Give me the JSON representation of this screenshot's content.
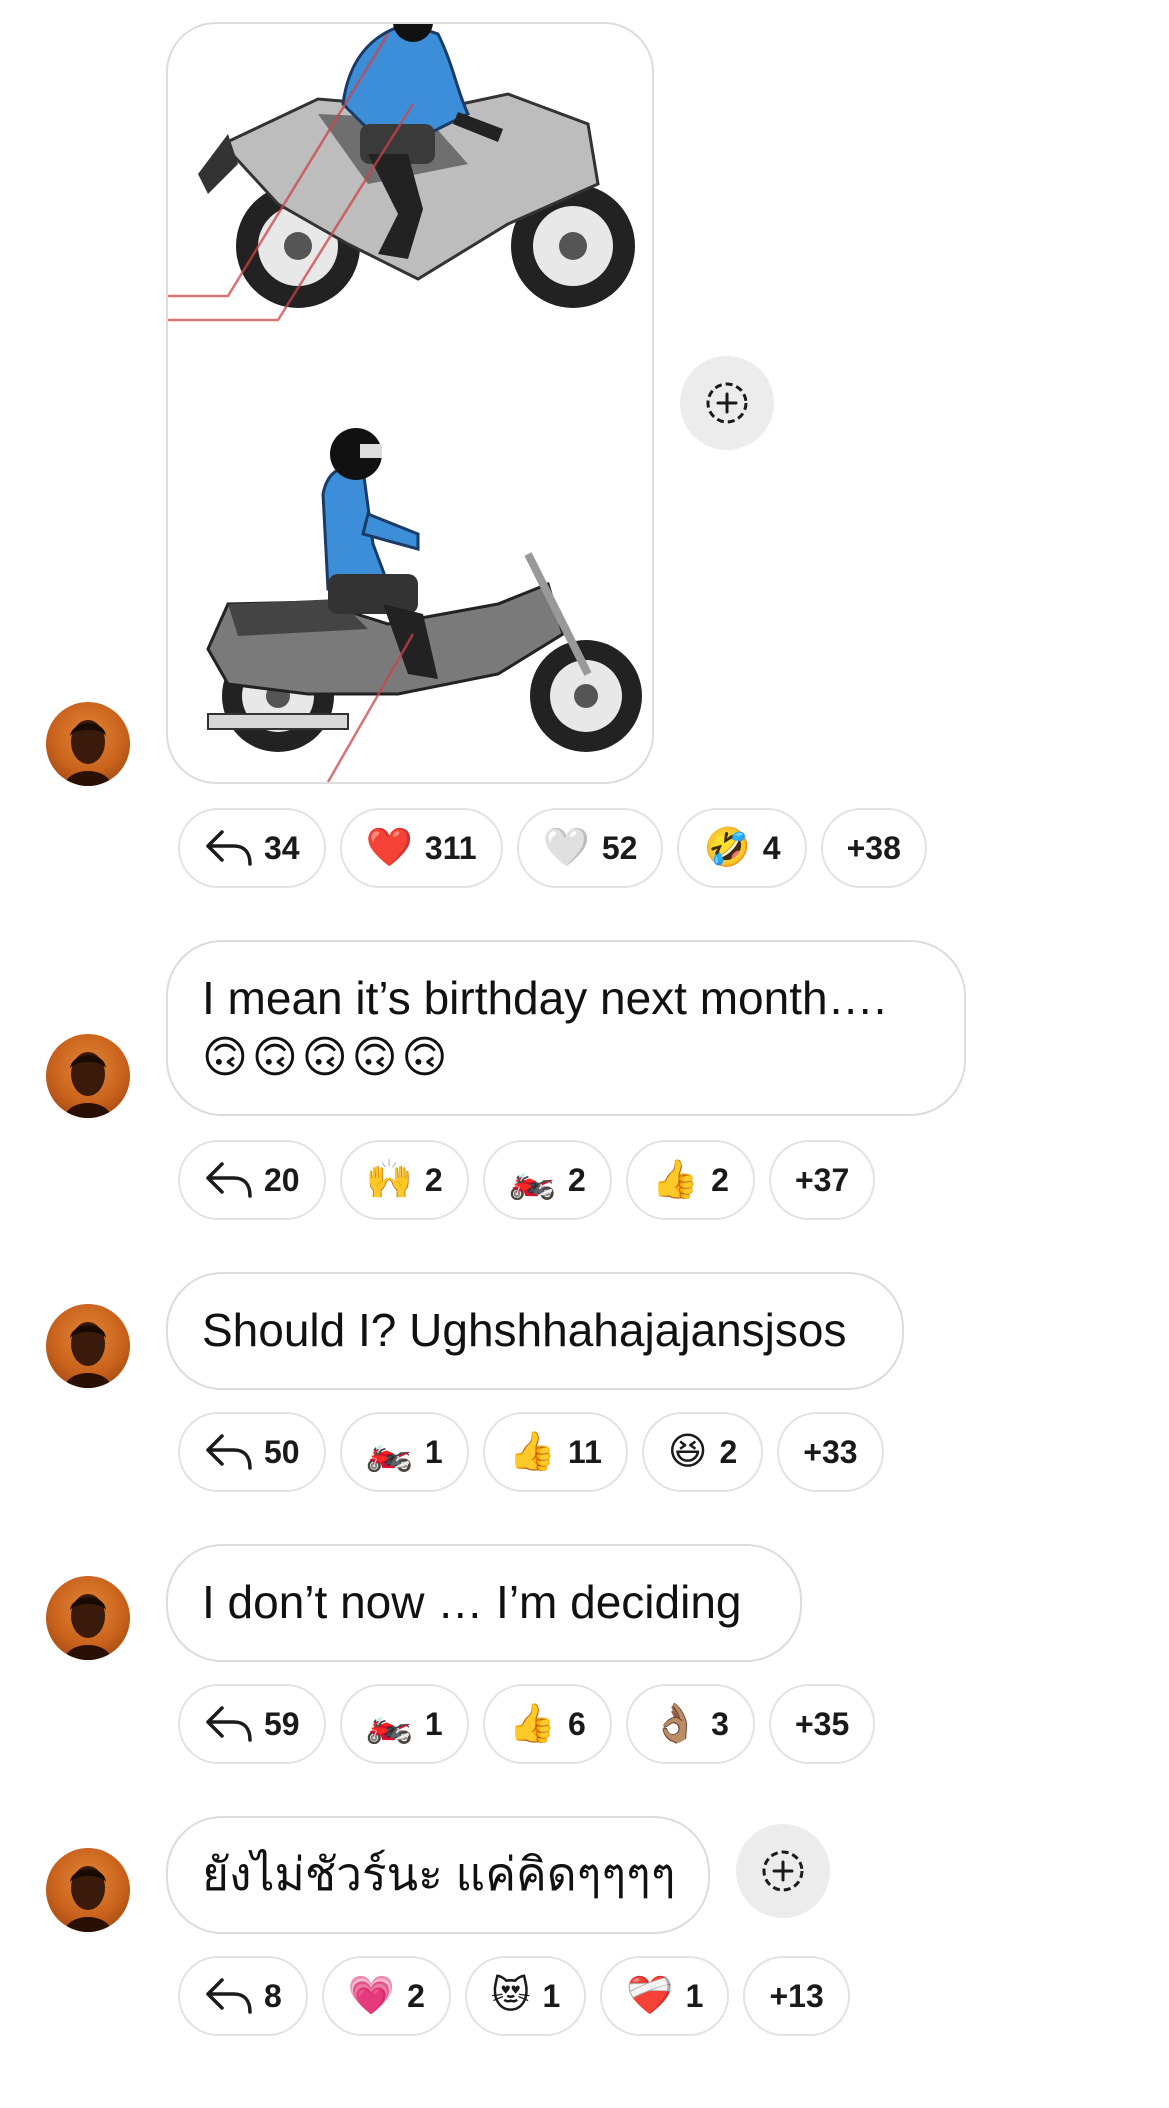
{
  "messages": [
    {
      "type": "image",
      "image_alt": "Two motorcycle riding posture illustrations",
      "reactions": {
        "replies": "34",
        "items": [
          {
            "emoji": "❤️",
            "count": "311"
          },
          {
            "emoji": "🤍",
            "count": "52"
          },
          {
            "emoji": "🤣",
            "count": "4"
          }
        ],
        "more": "+38"
      }
    },
    {
      "type": "text",
      "line1": "I mean it’s birthday next month….",
      "line2": "🙃🙃🙃🙃🙃",
      "reactions": {
        "replies": "20",
        "items": [
          {
            "emoji": "🙌",
            "count": "2"
          },
          {
            "emoji": "🏍️",
            "count": "2"
          },
          {
            "emoji": "👍",
            "count": "2"
          }
        ],
        "more": "+37"
      }
    },
    {
      "type": "text",
      "line1": "Should I? Ughshhahajajansjsos",
      "reactions": {
        "replies": "50",
        "items": [
          {
            "emoji": "🏍️",
            "count": "1"
          },
          {
            "emoji": "👍",
            "count": "11"
          },
          {
            "emoji": "😆",
            "count": "2"
          }
        ],
        "more": "+33"
      }
    },
    {
      "type": "text",
      "line1": "I don’t now … I’m deciding",
      "reactions": {
        "replies": "59",
        "items": [
          {
            "emoji": "🏍️",
            "count": "1"
          },
          {
            "emoji": "👍",
            "count": "6"
          },
          {
            "emoji": "👌🏽",
            "count": "3"
          }
        ],
        "more": "+35"
      }
    },
    {
      "type": "text",
      "line1": "ยังไม่ชัวร์นะ แค่คิดๆๆๆๆ",
      "reactions": {
        "replies": "8",
        "items": [
          {
            "emoji": "💗",
            "count": "2"
          },
          {
            "emoji": "😻",
            "count": "1"
          },
          {
            "emoji": "❤️‍🩹",
            "count": "1"
          }
        ],
        "more": "+13"
      }
    }
  ],
  "icons": {
    "reply": "reply-arrow-icon",
    "add_reaction": "add-reaction-icon",
    "avatar": "user-avatar"
  }
}
